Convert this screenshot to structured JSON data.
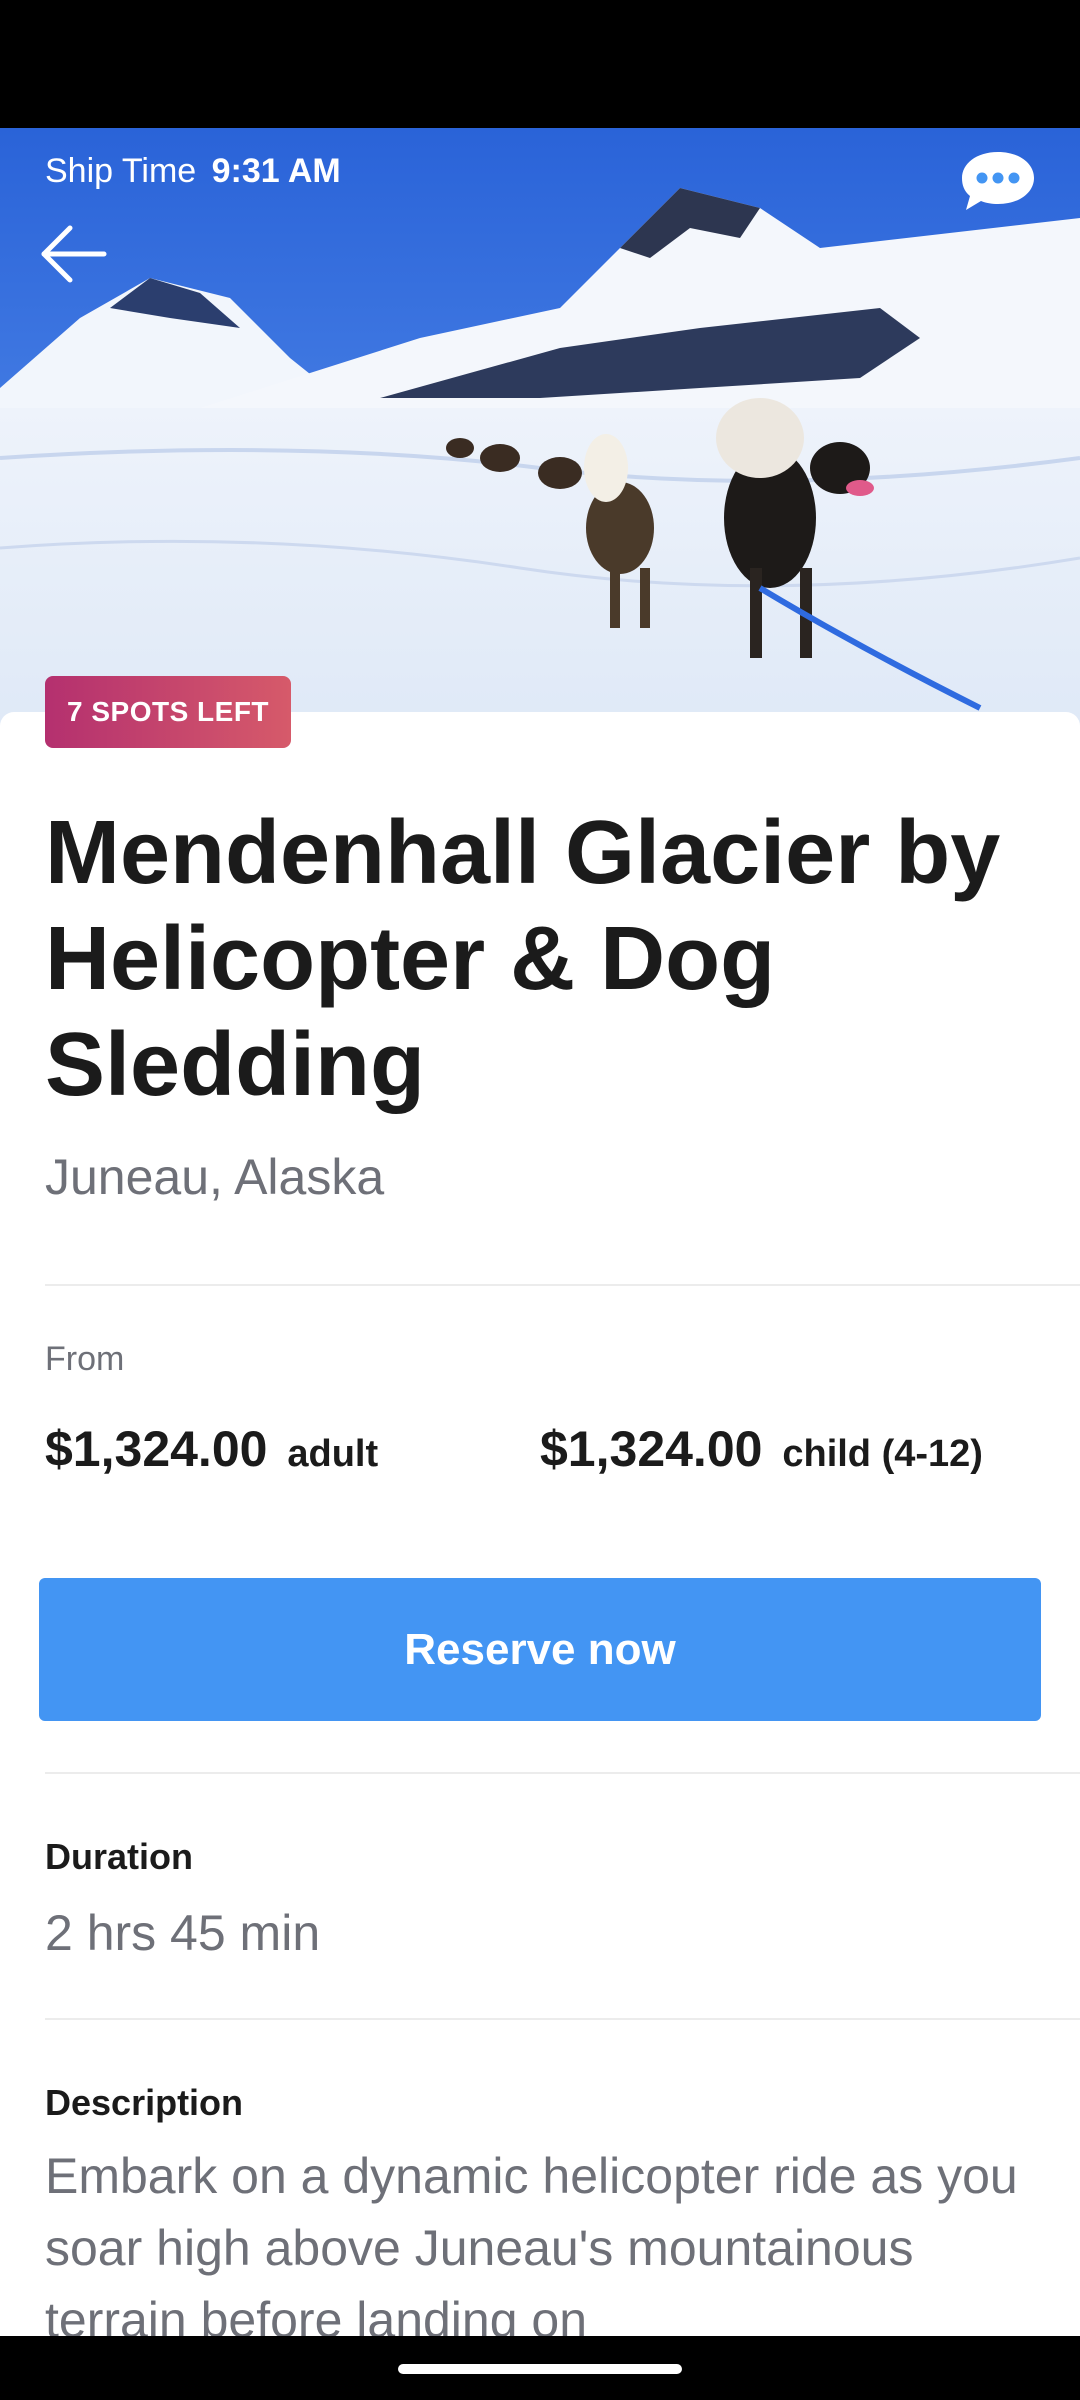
{
  "header": {
    "ship_time_label": "Ship Time",
    "ship_time_value": "9:31 AM",
    "back_icon": "arrow-left-icon",
    "chat_icon": "chat-bubble-icon"
  },
  "hero": {
    "image_description": "photo"
  },
  "badge": {
    "label": "7 SPOTS LEFT"
  },
  "excursion": {
    "title": "Mendenhall Glacier by Helicopter & Dog Sledding",
    "location": "Juneau, Alaska"
  },
  "pricing": {
    "from_label": "From",
    "adult_price": "$1,324.00",
    "adult_unit": "adult",
    "child_price": "$1,324.00",
    "child_unit": "child (4-12)"
  },
  "actions": {
    "reserve_label": "Reserve now"
  },
  "details": {
    "duration_label": "Duration",
    "duration_value": "2 hrs 45 min",
    "description_label": "Description",
    "description_text": "Embark on a dynamic helicopter ride as you soar high above Juneau's mountainous terrain before landing on"
  },
  "colors": {
    "accent": "#4395f3",
    "badge_start": "#b4306f",
    "badge_end": "#d65a6a"
  }
}
